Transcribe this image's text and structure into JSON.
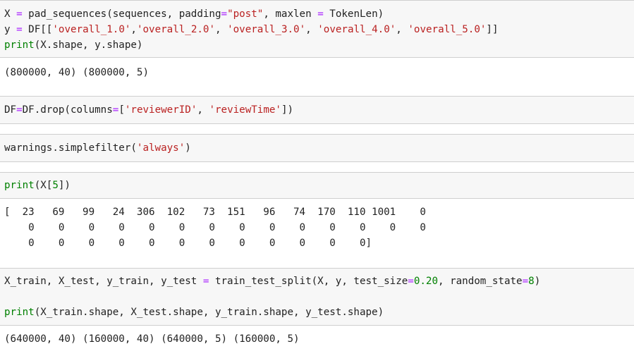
{
  "cells": [
    {
      "id": "c1",
      "input": [
        [
          {
            "t": "X "
          },
          {
            "t": "=",
            "c": "op"
          },
          {
            "t": " pad_sequences(sequences, padding"
          },
          {
            "t": "=",
            "c": "op"
          },
          {
            "t": "\"post\"",
            "c": "str"
          },
          {
            "t": ", maxlen "
          },
          {
            "t": "=",
            "c": "op"
          },
          {
            "t": " TokenLen)"
          }
        ],
        [
          {
            "t": "y "
          },
          {
            "t": "=",
            "c": "op"
          },
          {
            "t": " DF[["
          },
          {
            "t": "'overall_1.0'",
            "c": "str"
          },
          {
            "t": ","
          },
          {
            "t": "'overall_2.0'",
            "c": "str"
          },
          {
            "t": ", "
          },
          {
            "t": "'overall_3.0'",
            "c": "str"
          },
          {
            "t": ", "
          },
          {
            "t": "'overall_4.0'",
            "c": "str"
          },
          {
            "t": ", "
          },
          {
            "t": "'overall_5.0'",
            "c": "str"
          },
          {
            "t": "]]"
          }
        ],
        [
          {
            "t": "print",
            "c": "kw"
          },
          {
            "t": "(X.shape, y.shape)"
          }
        ]
      ],
      "output": [
        "(800000, 40) (800000, 5)"
      ]
    },
    {
      "id": "c2",
      "input": [
        [
          {
            "t": "DF"
          },
          {
            "t": "=",
            "c": "op"
          },
          {
            "t": "DF.drop(columns"
          },
          {
            "t": "=",
            "c": "op"
          },
          {
            "t": "["
          },
          {
            "t": "'reviewerID'",
            "c": "str"
          },
          {
            "t": ", "
          },
          {
            "t": "'reviewTime'",
            "c": "str"
          },
          {
            "t": "])"
          }
        ]
      ],
      "output": []
    },
    {
      "id": "c3",
      "input": [
        [
          {
            "t": "warnings.simplefilter("
          },
          {
            "t": "'always'",
            "c": "str"
          },
          {
            "t": ")"
          }
        ]
      ],
      "output": []
    },
    {
      "id": "c4",
      "input": [
        [
          {
            "t": "print",
            "c": "kw"
          },
          {
            "t": "(X["
          },
          {
            "t": "5",
            "c": "num"
          },
          {
            "t": "])"
          }
        ]
      ],
      "output": [
        "[  23   69   99   24  306  102   73  151   96   74  170  110 1001    0",
        "    0    0    0    0    0    0    0    0    0    0    0    0    0    0",
        "    0    0    0    0    0    0    0    0    0    0    0    0]"
      ]
    },
    {
      "id": "c5",
      "input": [
        [
          {
            "t": "X_train, X_test, y_train, y_test "
          },
          {
            "t": "=",
            "c": "op"
          },
          {
            "t": " train_test_split(X, y, test_size"
          },
          {
            "t": "=",
            "c": "op"
          },
          {
            "t": "0.20",
            "c": "num"
          },
          {
            "t": ", random_state"
          },
          {
            "t": "=",
            "c": "op"
          },
          {
            "t": "8",
            "c": "num"
          },
          {
            "t": ")"
          }
        ],
        [],
        [
          {
            "t": "print",
            "c": "kw"
          },
          {
            "t": "(X_train.shape, X_test.shape, y_train.shape, y_test.shape)"
          }
        ]
      ],
      "output": [
        "(640000, 40) (160000, 40) (640000, 5) (160000, 5)"
      ]
    }
  ]
}
